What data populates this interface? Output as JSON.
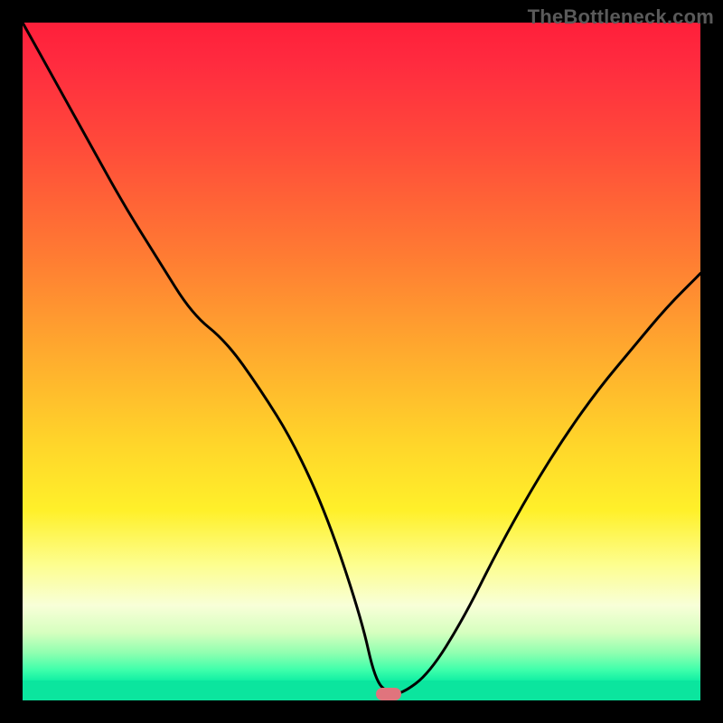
{
  "watermark": "TheBottleneck.com",
  "colors": {
    "background": "#000000",
    "curve": "#000000",
    "marker": "#e0747d",
    "gradient_stops": [
      "#ff1f3a",
      "#ff7a33",
      "#ffd52a",
      "#fdfe8f",
      "#3effab",
      "#0be59e"
    ]
  },
  "chart_data": {
    "type": "line",
    "title": "",
    "xlabel": "",
    "ylabel": "",
    "xlim": [
      0,
      100
    ],
    "ylim": [
      0,
      100
    ],
    "grid": false,
    "legend": false,
    "annotations": [
      {
        "kind": "marker-pill",
        "x": 54,
        "y": 1,
        "color": "#e0747d"
      },
      {
        "kind": "watermark",
        "text": "TheBottleneck.com",
        "position": "top-right"
      }
    ],
    "series": [
      {
        "name": "bottleneck-curve",
        "comment": "Percentage-like metric that falls from ~100 on the left to ~0 near x≈54, then rises again toward ~63 at the right edge. Values estimated from the rendered curve against the gradient; no axis ticks are shown.",
        "x": [
          0,
          5,
          10,
          15,
          20,
          25,
          30,
          35,
          40,
          45,
          50,
          52,
          54,
          56,
          60,
          65,
          70,
          75,
          80,
          85,
          90,
          95,
          100
        ],
        "values": [
          100,
          91,
          82,
          73,
          65,
          57,
          53,
          46,
          38,
          27,
          12,
          3,
          1,
          1,
          4,
          12,
          22,
          31,
          39,
          46,
          52,
          58,
          63
        ]
      }
    ],
    "background_gradient": {
      "direction": "vertical",
      "meaning": "higher on chart = higher bottleneck (red); lower = balanced (green)"
    }
  }
}
